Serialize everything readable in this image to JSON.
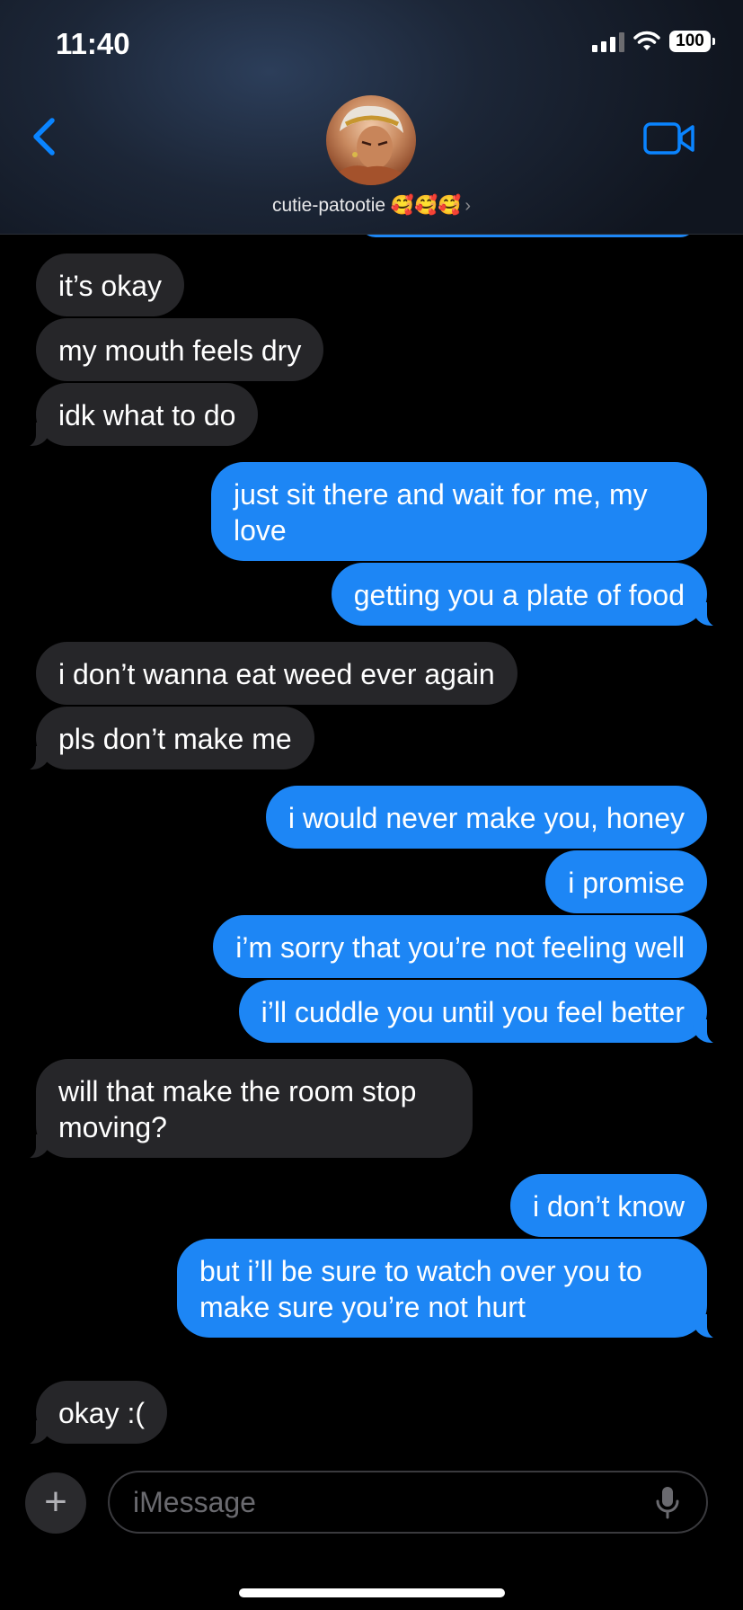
{
  "status_bar": {
    "time": "11:40",
    "battery": "100"
  },
  "header": {
    "contact_name": "cutie-patootie 🥰🥰🥰",
    "back_icon": "chevron-left-icon",
    "video_icon": "video-camera-icon"
  },
  "messages": [
    {
      "from": "them",
      "text": "it’s okay"
    },
    {
      "from": "them",
      "text": "my mouth feels dry"
    },
    {
      "from": "them",
      "text": "idk what to do"
    },
    {
      "from": "me",
      "text": "just sit there and wait for me, my\nlove"
    },
    {
      "from": "me",
      "text": "getting you a plate of food"
    },
    {
      "from": "them",
      "text": "i don’t wanna eat weed ever again"
    },
    {
      "from": "them",
      "text": "pls don’t make me"
    },
    {
      "from": "me",
      "text": "i would never make you, honey"
    },
    {
      "from": "me",
      "text": "i promise"
    },
    {
      "from": "me",
      "text": "i’m sorry that you’re not feeling well"
    },
    {
      "from": "me",
      "text": "i’ll cuddle you until you feel better"
    },
    {
      "from": "them",
      "text": "will that make the room stop\nmoving?"
    },
    {
      "from": "me",
      "text": "i don’t know"
    },
    {
      "from": "me",
      "text": "but i’ll be sure to watch over you to\nmake sure you’re not hurt"
    },
    {
      "from": "them",
      "text": "okay :("
    }
  ],
  "composer": {
    "placeholder": "iMessage",
    "value": "",
    "add_icon": "plus-icon",
    "mic_icon": "microphone-icon"
  },
  "colors": {
    "incoming": "#262629",
    "outgoing": "#1d86f5",
    "accent": "#0a84ff"
  }
}
